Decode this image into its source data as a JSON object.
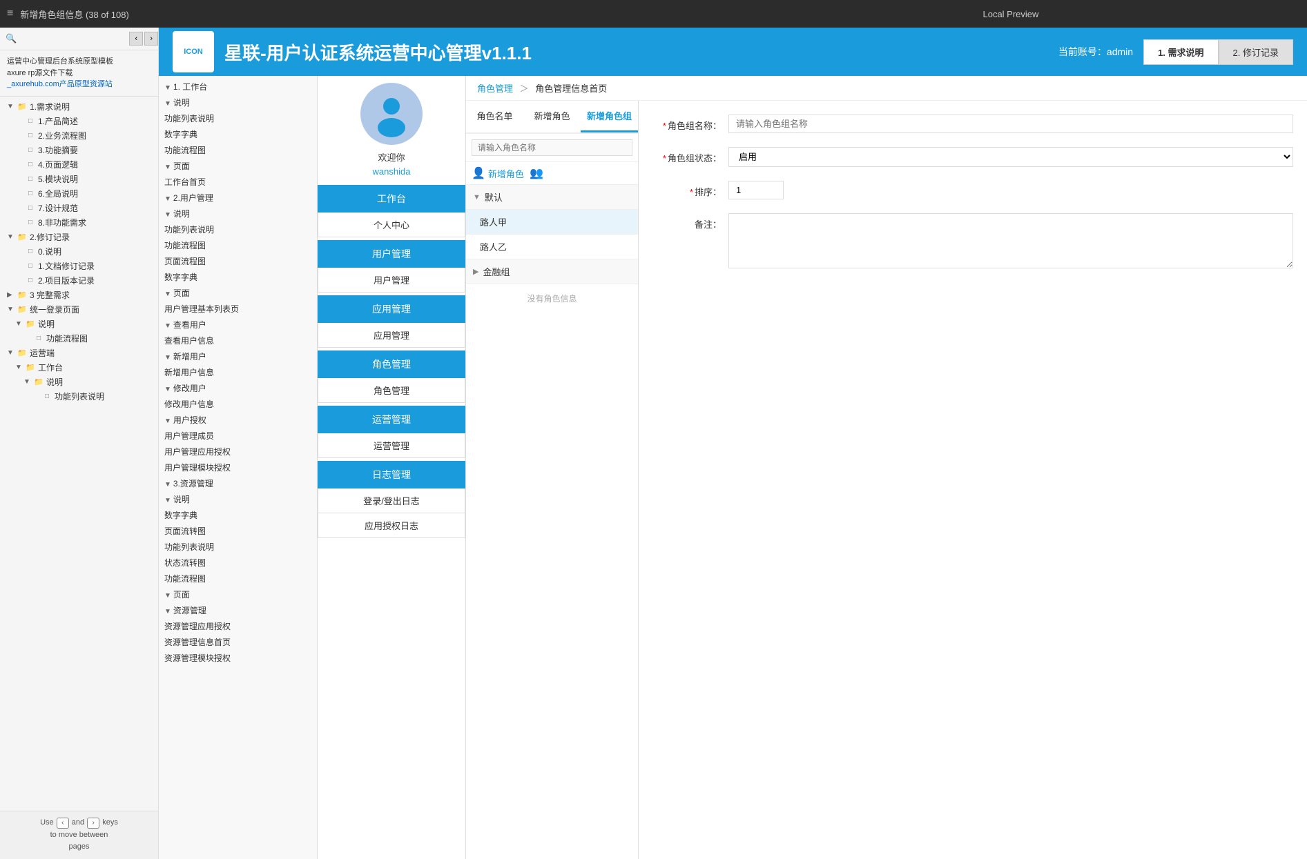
{
  "window": {
    "title": "新增角色组信息 (38 of 108)",
    "preview_label": "Local Preview"
  },
  "sidebar": {
    "search_placeholder": "",
    "promo_text": "运营中心管理后台系统原型模板\naxure rp源文件下载\n_axurehub.com产品原型资源站",
    "tree": [
      {
        "level": 1,
        "toggle": "▼",
        "icon": "folder",
        "label": "1.需求说明",
        "selected": false
      },
      {
        "level": 2,
        "toggle": "",
        "icon": "page",
        "label": "1.产品简述"
      },
      {
        "level": 2,
        "toggle": "",
        "icon": "page",
        "label": "2.业务流程图"
      },
      {
        "level": 2,
        "toggle": "",
        "icon": "page",
        "label": "3.功能摘要"
      },
      {
        "level": 2,
        "toggle": "",
        "icon": "page",
        "label": "4.页面逻辑"
      },
      {
        "level": 2,
        "toggle": "",
        "icon": "page",
        "label": "5.模块说明"
      },
      {
        "level": 2,
        "toggle": "",
        "icon": "page",
        "label": "6.全局说明"
      },
      {
        "level": 2,
        "toggle": "",
        "icon": "page",
        "label": "7.设计规范"
      },
      {
        "level": 2,
        "toggle": "",
        "icon": "page",
        "label": "8.非功能需求"
      },
      {
        "level": 1,
        "toggle": "▼",
        "icon": "folder",
        "label": "2.修订记录"
      },
      {
        "level": 2,
        "toggle": "",
        "icon": "page",
        "label": "0.说明"
      },
      {
        "level": 2,
        "toggle": "",
        "icon": "page",
        "label": "1.文档修订记录"
      },
      {
        "level": 2,
        "toggle": "",
        "icon": "page",
        "label": "2.项目版本记录"
      },
      {
        "level": 1,
        "toggle": "▶",
        "icon": "folder",
        "label": "3 完整需求"
      },
      {
        "level": 1,
        "toggle": "▼",
        "icon": "folder",
        "label": "统一登录页面"
      },
      {
        "level": 2,
        "toggle": "▼",
        "icon": "folder",
        "label": "说明"
      },
      {
        "level": 3,
        "toggle": "",
        "icon": "page",
        "label": "功能流程图"
      },
      {
        "level": 1,
        "toggle": "▼",
        "icon": "folder",
        "label": "运营端"
      },
      {
        "level": 2,
        "toggle": "▼",
        "icon": "folder",
        "label": "工作台"
      },
      {
        "level": 3,
        "toggle": "▼",
        "icon": "folder",
        "label": "说明"
      },
      {
        "level": 4,
        "toggle": "",
        "icon": "page",
        "label": "功能列表说明"
      }
    ],
    "bottom_text": "Use  and  keys to move between pages"
  },
  "app_header": {
    "logo_text": "ICON",
    "title": "星联-用户认证系统运营中心管理v1.1.1",
    "account_label": "当前账号：admin",
    "tab1": "1. 需求说明",
    "tab2": "2. 修订记录"
  },
  "left_nav": {
    "items": [
      {
        "level": 1,
        "toggle": "▼",
        "label": "1. 工作台"
      },
      {
        "level": 2,
        "toggle": "▼",
        "label": "说明"
      },
      {
        "level": 3,
        "toggle": "",
        "label": "功能列表说明"
      },
      {
        "level": 3,
        "toggle": "",
        "label": "数字字典"
      },
      {
        "level": 3,
        "toggle": "",
        "label": "功能流程图"
      },
      {
        "level": 2,
        "toggle": "▼",
        "label": "页面"
      },
      {
        "level": 3,
        "toggle": "",
        "label": "工作台首页"
      },
      {
        "level": 1,
        "toggle": "▼",
        "label": "2.用户管理"
      },
      {
        "level": 2,
        "toggle": "▼",
        "label": "说明"
      },
      {
        "level": 3,
        "toggle": "",
        "label": "功能列表说明"
      },
      {
        "level": 3,
        "toggle": "",
        "label": "功能流程图"
      },
      {
        "level": 3,
        "toggle": "",
        "label": "页面流程图"
      },
      {
        "level": 3,
        "toggle": "",
        "label": "数字字典"
      },
      {
        "level": 2,
        "toggle": "▼",
        "label": "页面"
      },
      {
        "level": 3,
        "toggle": "",
        "label": "用户管理基本列表页"
      },
      {
        "level": 3,
        "toggle": "▼",
        "label": "查看用户"
      },
      {
        "level": 4,
        "toggle": "",
        "label": "查看用户信息"
      },
      {
        "level": 3,
        "toggle": "▼",
        "label": "新增用户"
      },
      {
        "level": 4,
        "toggle": "",
        "label": "新增用户信息"
      },
      {
        "level": 3,
        "toggle": "▼",
        "label": "修改用户"
      },
      {
        "level": 4,
        "toggle": "",
        "label": "修改用户信息"
      },
      {
        "level": 3,
        "toggle": "▼",
        "label": "用户授权"
      },
      {
        "level": 4,
        "toggle": "",
        "label": "用户管理成员"
      },
      {
        "level": 4,
        "toggle": "",
        "label": "用户管理应用授权"
      },
      {
        "level": 4,
        "toggle": "",
        "label": "用户管理模块授权"
      },
      {
        "level": 1,
        "toggle": "▼",
        "label": "3.资源管理"
      },
      {
        "level": 2,
        "toggle": "▼",
        "label": "说明"
      },
      {
        "level": 3,
        "toggle": "",
        "label": "数字字典"
      },
      {
        "level": 3,
        "toggle": "",
        "label": "页面流转图"
      },
      {
        "level": 3,
        "toggle": "",
        "label": "功能列表说明"
      },
      {
        "level": 3,
        "toggle": "",
        "label": "状态流转图"
      },
      {
        "level": 3,
        "toggle": "",
        "label": "功能流程图"
      },
      {
        "level": 2,
        "toggle": "▼",
        "label": "页面"
      },
      {
        "level": 3,
        "toggle": "▼",
        "label": "资源管理"
      },
      {
        "level": 4,
        "toggle": "",
        "label": "资源管理应用授权"
      },
      {
        "level": 4,
        "toggle": "",
        "label": "资源管理信息首页"
      },
      {
        "level": 4,
        "toggle": "",
        "label": "资源管理模块授权"
      }
    ]
  },
  "app_nav": {
    "user_welcome": "欢迎你",
    "user_name": "wanshida",
    "nav_groups": [
      {
        "active_label": "工作台",
        "sub_labels": [
          "个人中心"
        ]
      },
      {
        "active_label": "用户管理",
        "sub_labels": [
          "用户管理"
        ]
      },
      {
        "active_label": "应用管理",
        "sub_labels": [
          "应用管理"
        ]
      },
      {
        "active_label": "角色管理",
        "sub_labels": [
          "角色管理"
        ]
      },
      {
        "active_label": "运营管理",
        "sub_labels": [
          "运营管理"
        ]
      },
      {
        "active_label": "日志管理",
        "sub_labels": [
          "登录/登出日志",
          "应用授权日志"
        ]
      }
    ]
  },
  "breadcrumb": {
    "parts": [
      "角色管理",
      "角色管理信息首页"
    ]
  },
  "role_panel": {
    "tabs": [
      "角色名单",
      "新增角色",
      "新增角色组"
    ],
    "active_tab": 2,
    "search_placeholder": "请输入角色名称",
    "add_role_label": "新增角色",
    "add_role_group_label": "",
    "groups": [
      {
        "label": "默认",
        "toggle": "▼",
        "roles": [
          "路人甲",
          "路人乙"
        ]
      },
      {
        "label": "金融组",
        "toggle": "▶",
        "roles": []
      }
    ],
    "no_role_info": "没有角色信息"
  },
  "role_form": {
    "group_name_label": "*角色组名称：",
    "group_name_placeholder": "请输入角色组名称",
    "group_status_label": "*角色组状态：",
    "group_status_value": "启用",
    "sort_label": "*排序：",
    "sort_value": "1",
    "remark_label": "备注：",
    "remark_value": ""
  },
  "colors": {
    "primary": "#1a9bdc",
    "header_bg": "#1a9bdc",
    "active_nav": "#1a9bdc",
    "active_tab_underline": "#1a9bdc"
  }
}
